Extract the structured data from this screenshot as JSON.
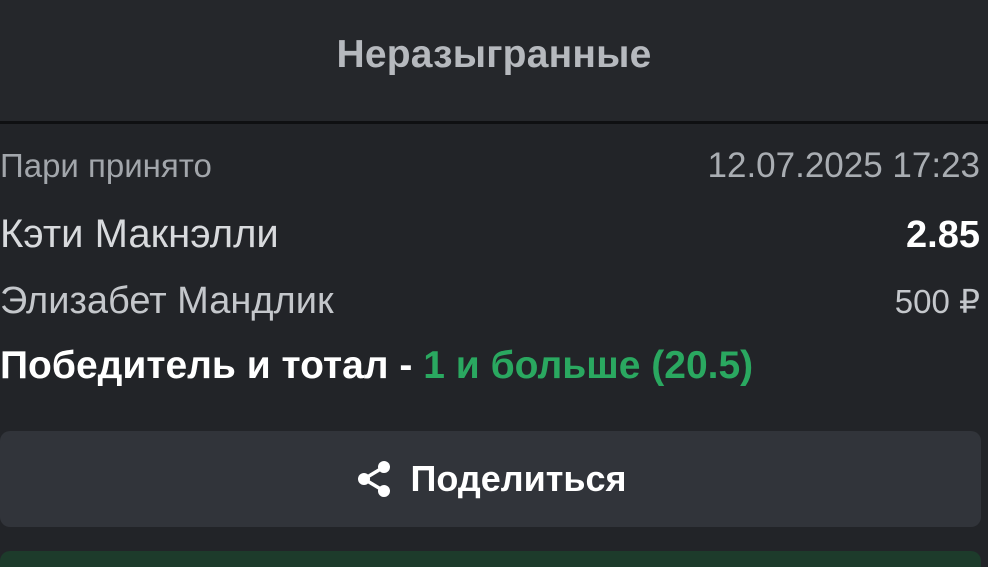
{
  "header": {
    "title": "Неразыгранные"
  },
  "bet": {
    "accepted_label": "Пари принято",
    "accepted_datetime": "12.07.2025 17:23",
    "player1": "Кэти Макнэлли",
    "odds": "2.85",
    "player2": "Элизабет Мандлик",
    "stake": "500 ₽",
    "market_name": "Победитель и тотал",
    "market_separator": " - ",
    "outcome": "1 и больше (20.5)"
  },
  "actions": {
    "share_label": "Поделиться"
  },
  "icons": {
    "share": "share-icon"
  },
  "colors": {
    "background": "#222428",
    "header_background": "#25272b",
    "button_background": "#31343a",
    "outcome_green": "#2aa860",
    "next_button": "#1d3b2b"
  }
}
